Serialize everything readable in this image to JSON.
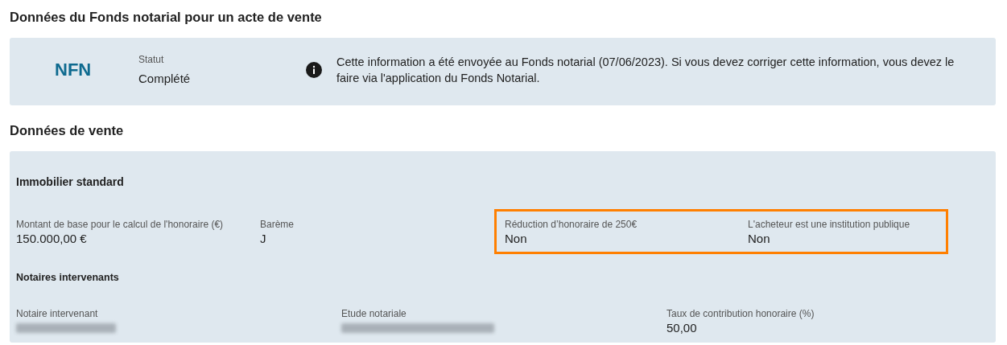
{
  "nfn_section": {
    "title": "Données du Fonds notarial pour un acte de vente",
    "logo": "NFN",
    "status": {
      "label": "Statut",
      "value": "Complété"
    },
    "info": "Cette information a été envoyée au Fonds notarial (07/06/2023). Si vous devez corriger cette information, vous devez le faire via l'application du Fonds Notarial."
  },
  "sale_section": {
    "title": "Données de vente",
    "subtitle": "Immobilier standard",
    "field_groups": [
      {
        "highlighted": false,
        "fields": [
          {
            "label": "Montant de base pour le calcul de l'honoraire (€)",
            "value": "150.000,00 €"
          },
          {
            "label": "Barème",
            "value": "J"
          }
        ]
      },
      {
        "highlighted": true,
        "fields": [
          {
            "label": "Réduction d’honoraire de 250€",
            "value": "Non"
          },
          {
            "label": "L'acheteur est une institution publique",
            "value": "Non"
          }
        ]
      }
    ],
    "notaries": {
      "title": "Notaires intervenants",
      "fields": [
        {
          "label": "Notaire intervenant",
          "redacted": true
        },
        {
          "label": "Etude notariale",
          "redacted": true
        },
        {
          "label": "Taux de contribution honoraire (%)",
          "value": "50,00",
          "redacted": false
        }
      ]
    }
  }
}
